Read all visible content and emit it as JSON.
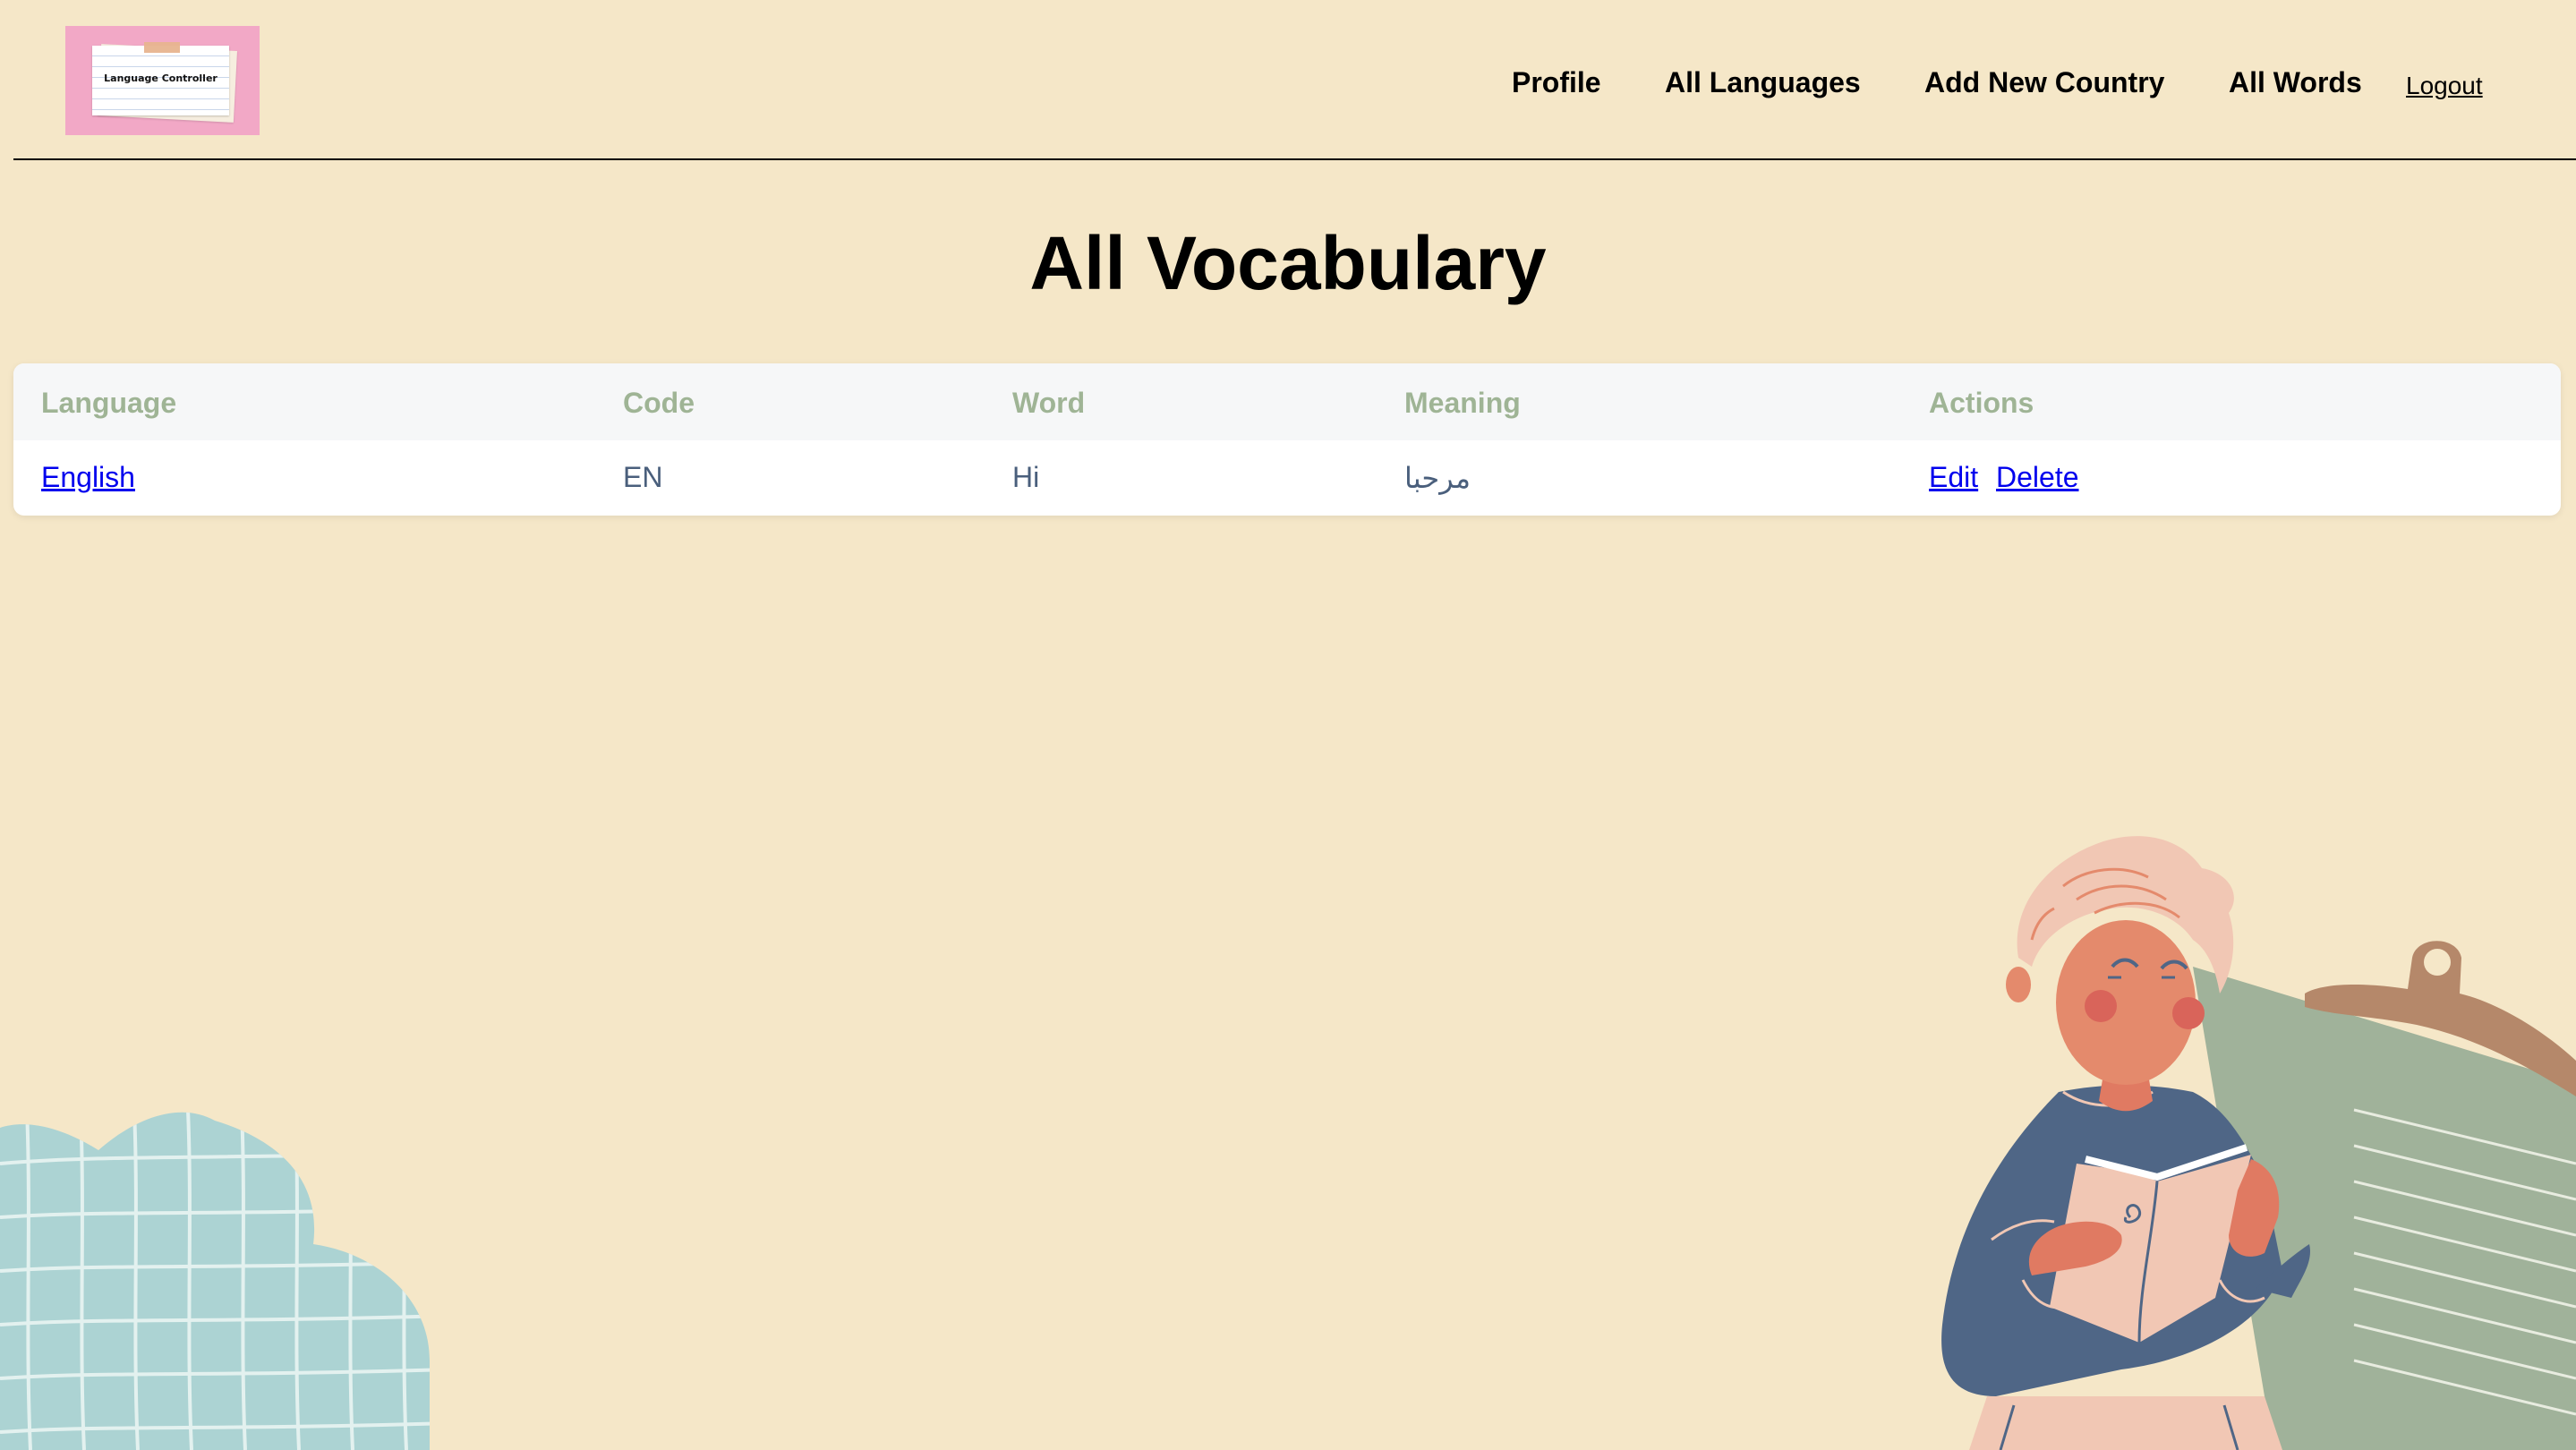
{
  "header": {
    "logo_text": "Language Controller",
    "nav": {
      "profile": "Profile",
      "all_languages": "All Languages",
      "add_new_country": "Add New Country",
      "all_words": "All Words",
      "logout": "Logout"
    }
  },
  "page": {
    "title": "All Vocabulary"
  },
  "table": {
    "headers": {
      "language": "Language",
      "code": "Code",
      "word": "Word",
      "meaning": "Meaning",
      "actions": "Actions"
    },
    "rows": [
      {
        "language": "English",
        "code": "EN",
        "word": "Hi",
        "meaning": "مرحبا",
        "edit": "Edit",
        "delete": "Delete"
      }
    ]
  },
  "colors": {
    "background": "#f5e7c8",
    "logo_bg": "#f2a8c6",
    "table_header_text": "#9fb495",
    "table_cell_text": "#4a5f7c",
    "link": "#0000ee"
  },
  "illustrations": {
    "left": "teal-grid-blob",
    "right": "person-reading-book-with-clipboard"
  }
}
